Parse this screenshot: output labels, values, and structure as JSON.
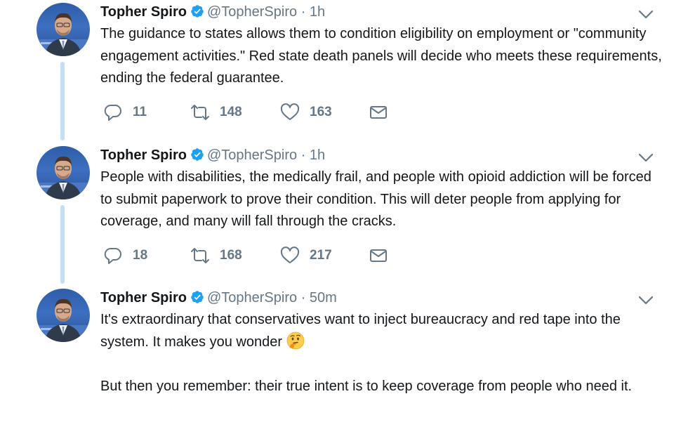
{
  "tweets": [
    {
      "name": "Topher Spiro",
      "handle": "@TopherSpiro",
      "separator": "·",
      "time": "1h",
      "text": "The guidance to states allows them to condition eligibility on employment or \"community engagement activities.\" Red state death panels will decide who meets these requirements, ending the federal guarantee.",
      "replies": "11",
      "retweets": "148",
      "likes": "163"
    },
    {
      "name": "Topher Spiro",
      "handle": "@TopherSpiro",
      "separator": "·",
      "time": "1h",
      "text": "People with disabilities, the medically frail, and people with opioid addiction will be forced to submit paperwork to prove their condition. This will deter people from applying for coverage, and many will fall through the cracks.",
      "replies": "18",
      "retweets": "168",
      "likes": "217"
    },
    {
      "name": "Topher Spiro",
      "handle": "@TopherSpiro",
      "separator": "·",
      "time": "50m",
      "text_part1": "It's extraordinary that conservatives want to inject bureaucracy and red tape into the system. It makes you wonder",
      "emoji": "thinking-face-emoji",
      "text_part2": "But then you remember: their true intent is to keep coverage from people who need it."
    }
  ],
  "colors": {
    "verified": "#1da1f2",
    "thread_line": "#c4dff5",
    "secondary_text": "#657786"
  },
  "icons": {
    "reply": "reply-icon",
    "retweet": "retweet-icon",
    "like": "heart-icon",
    "message": "envelope-icon",
    "more": "chevron-down-icon",
    "verified": "verified-badge-icon"
  }
}
